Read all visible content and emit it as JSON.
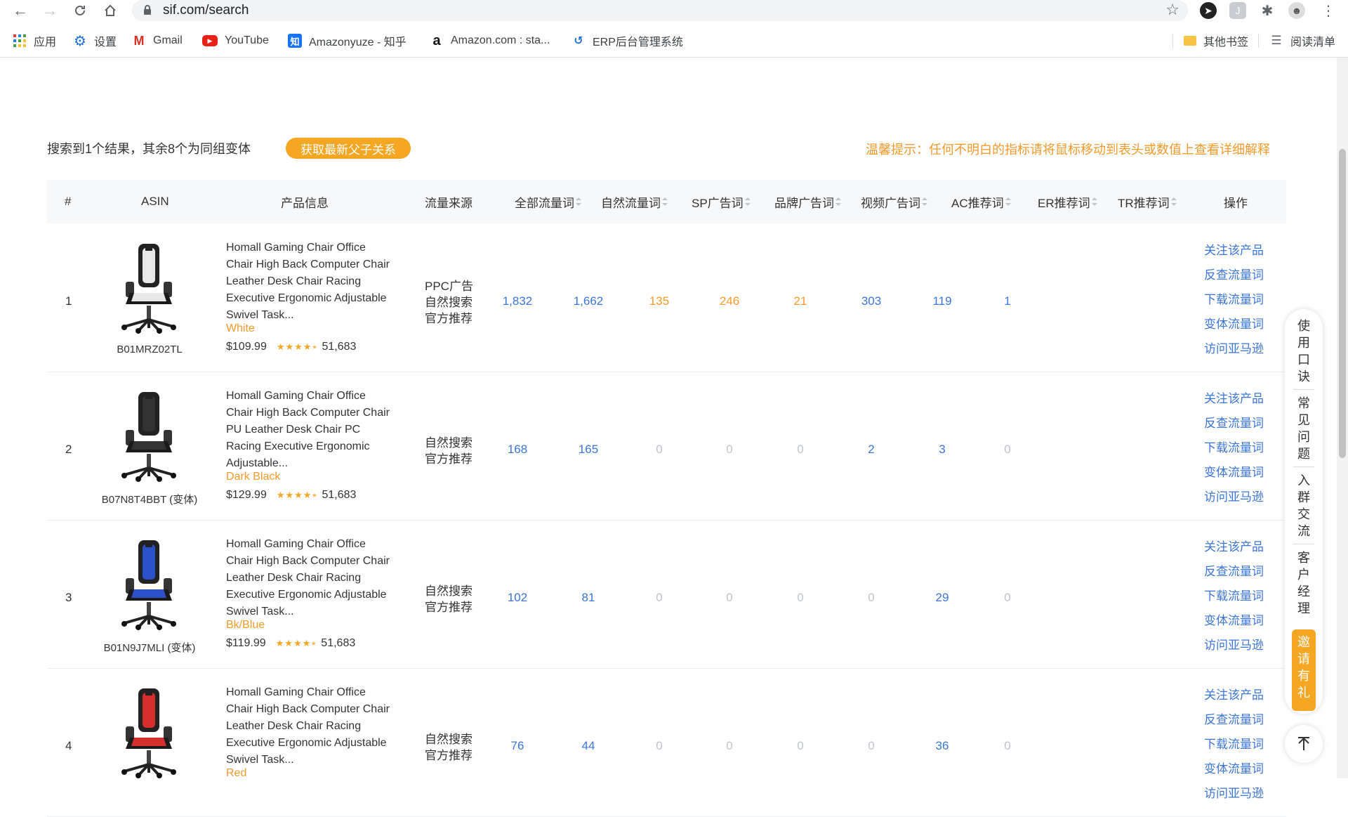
{
  "browser": {
    "url": "sif.com/search",
    "bookmarks": [
      {
        "label": "应用",
        "icon": "apps-grid-icon"
      },
      {
        "label": "设置",
        "icon": "gear-icon"
      },
      {
        "label": "Gmail",
        "icon": "gmail-icon"
      },
      {
        "label": "YouTube",
        "icon": "youtube-icon"
      },
      {
        "label": "Amazonyuze - 知乎",
        "icon": "zhihu-icon"
      },
      {
        "label": "Amazon.com : sta...",
        "icon": "amazon-icon"
      },
      {
        "label": "ERP后台管理系统",
        "icon": "erp-icon"
      }
    ],
    "other_bookmarks": "其他书签",
    "reading_list": "阅读清单"
  },
  "page": {
    "summary": "搜索到1个结果，其余8个为同组变体",
    "fetch_button": "获取最新父子关系",
    "tip": "温馨提示：任何不明白的指标请将鼠标移动到表头或数值上查看详细解释"
  },
  "table": {
    "headers": [
      "#",
      "ASIN",
      "产品信息",
      "流量来源",
      "全部流量词",
      "自然流量词",
      "SP广告词",
      "品牌广告词",
      "视频广告词",
      "AC推荐词",
      "ER推荐词",
      "TR推荐词",
      "操作"
    ],
    "ops": [
      "关注该产品",
      "反查流量词",
      "下载流量词",
      "变体流量词",
      "访问亚马逊"
    ],
    "rows": [
      {
        "idx": "1",
        "asin": "B01MRZ02TL",
        "title": "Homall Gaming Chair Office Chair High Back Computer Chair Leather Desk Chair Racing Executive Ergonomic Adjustable Swivel Task...",
        "variant": "White",
        "price": "$109.99",
        "reviews": "51,683",
        "source": [
          "PPC广告",
          "自然搜索",
          "官方推荐"
        ],
        "values": [
          "1,832",
          "1,662",
          "135",
          "246",
          "21",
          "303",
          "119",
          "1"
        ],
        "chair_color": "#e8e8e8"
      },
      {
        "idx": "2",
        "asin": "B07N8T4BBT (变体)",
        "title": "Homall Gaming Chair Office Chair High Back Computer Chair PU Leather Desk Chair PC Racing Executive Ergonomic Adjustable...",
        "variant": "Dark Black",
        "price": "$129.99",
        "reviews": "51,683",
        "source": [
          "自然搜索",
          "官方推荐"
        ],
        "values": [
          "168",
          "165",
          "0",
          "0",
          "0",
          "2",
          "3",
          "0"
        ],
        "chair_color": "#333333"
      },
      {
        "idx": "3",
        "asin": "B01N9J7MLI (变体)",
        "title": "Homall Gaming Chair Office Chair High Back Computer Chair Leather Desk Chair Racing Executive Ergonomic Adjustable Swivel Task...",
        "variant": "Bk/Blue",
        "price": "$119.99",
        "reviews": "51,683",
        "source": [
          "自然搜索",
          "官方推荐"
        ],
        "values": [
          "102",
          "81",
          "0",
          "0",
          "0",
          "0",
          "29",
          "0"
        ],
        "chair_color": "#2b52c9"
      },
      {
        "idx": "4",
        "asin": "",
        "title": "Homall Gaming Chair Office Chair High Back Computer Chair Leather Desk Chair Racing Executive Ergonomic Adjustable Swivel Task...",
        "variant": "Red",
        "price": "",
        "reviews": "",
        "source": [
          "自然搜索",
          "官方推荐"
        ],
        "values": [
          "76",
          "44",
          "0",
          "0",
          "0",
          "0",
          "36",
          "0"
        ],
        "chair_color": "#d62d2d"
      }
    ]
  },
  "sidebar_float": {
    "items": [
      "使用口诀",
      "常见问题",
      "入群交流",
      "客户经理"
    ],
    "invite": "邀请有礼"
  },
  "colors": {
    "accent": "#f5a623",
    "link": "#3a75d8",
    "tip": "#f39a2b"
  }
}
